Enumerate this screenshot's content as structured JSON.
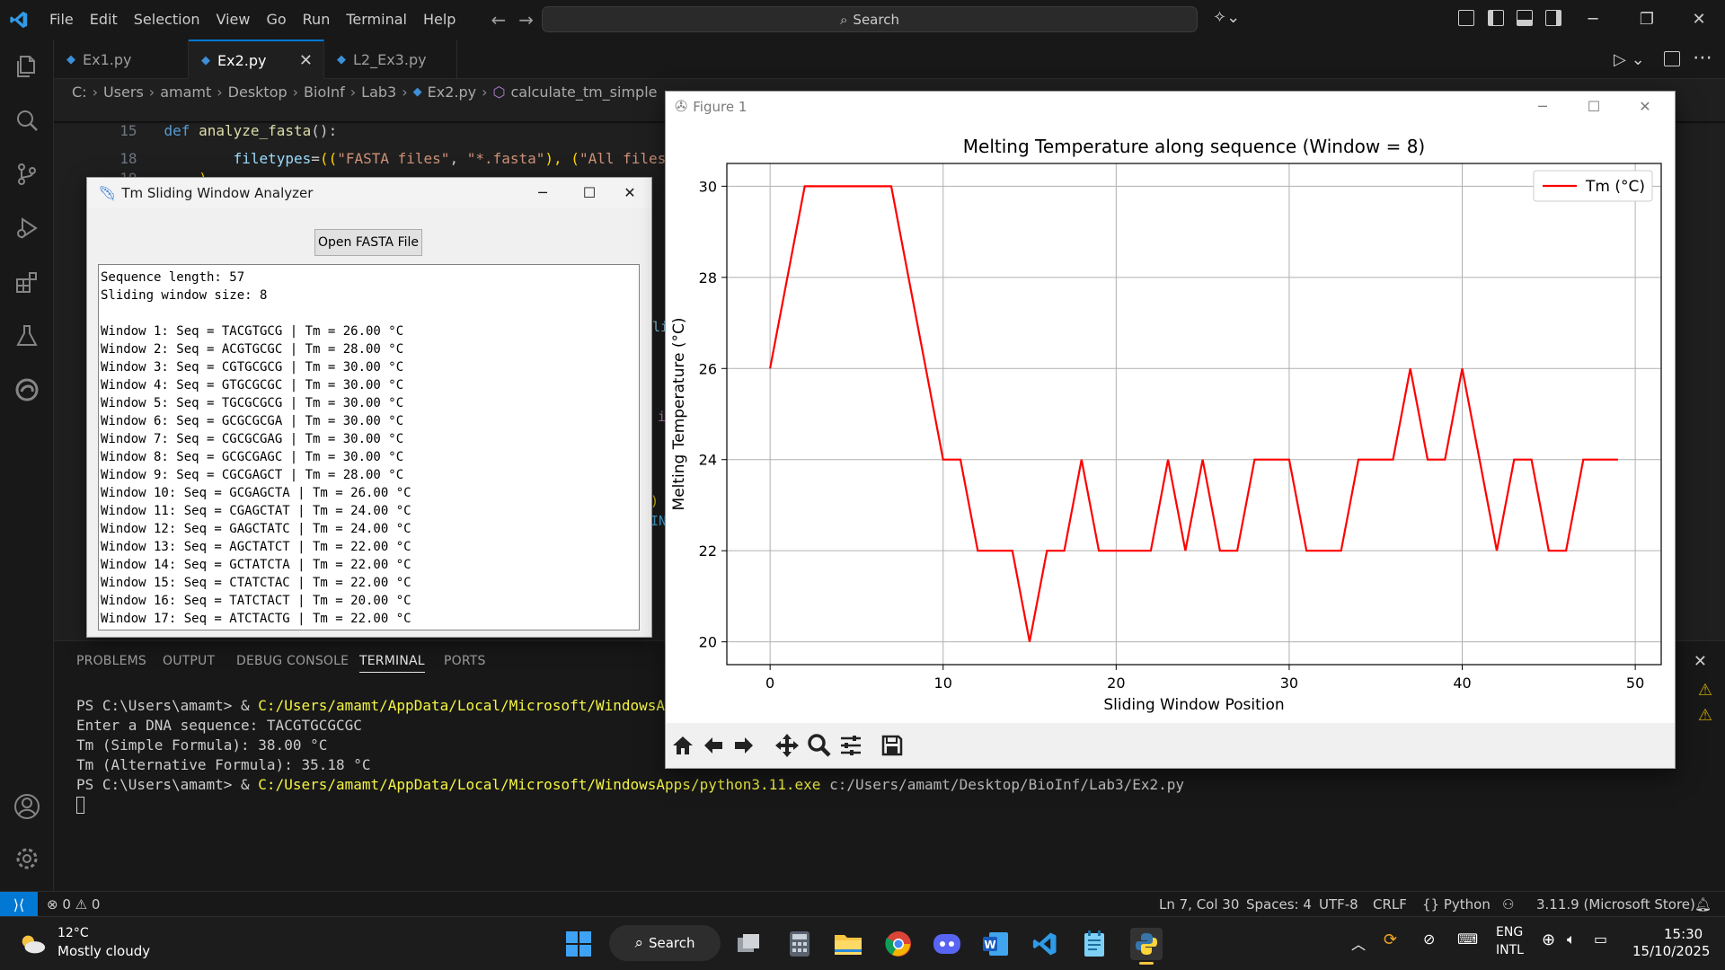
{
  "menu": [
    "File",
    "Edit",
    "Selection",
    "View",
    "Go",
    "Run",
    "Terminal",
    "Help"
  ],
  "command_search": "Search",
  "tabs": [
    {
      "label": "Ex1.py"
    },
    {
      "label": "Ex2.py"
    },
    {
      "label": "L2_Ex3.py"
    }
  ],
  "breadcrumb": [
    "C:",
    "Users",
    "amamt",
    "Desktop",
    "BioInf",
    "Lab3",
    "Ex2.py",
    "calculate_tm_simple"
  ],
  "editor": {
    "line15": {
      "num": "15",
      "kw": "def ",
      "fn": "analyze_fasta",
      "rest": "():"
    },
    "line18": {
      "num": "18",
      "indent": "        ",
      "name": "filetypes",
      "eq": "=",
      "p1": "((",
      "s1": "\"FASTA files\"",
      "c1": ", ",
      "s2": "\"*.fasta\"",
      "c2": "), (",
      "s3": "\"All files\"",
      "c3": ", \""
    },
    "line19": {
      "num": "19",
      "text": "    )"
    },
    "frag_li": "li",
    "frag_i": "i",
    "frag_paren": ")",
    "frag_in": "IN"
  },
  "panel": {
    "tabs": [
      "PROBLEMS",
      "OUTPUT",
      "DEBUG CONSOLE",
      "TERMINAL",
      "PORTS"
    ],
    "terminal": [
      {
        "prefix": "PS C:\\Users\\amamt> & ",
        "yellow": "C:/Users/amamt/AppData/Local/Microsoft/WindowsApps/p",
        "rest": ""
      },
      {
        "prefix": "Enter a DNA sequence: TACGTGCGCGC",
        "yellow": "",
        "rest": ""
      },
      {
        "prefix": "Tm (Simple Formula): 38.00 °C",
        "yellow": "",
        "rest": ""
      },
      {
        "prefix": "Tm (Alternative Formula): 35.18 °C",
        "yellow": "",
        "rest": ""
      },
      {
        "prefix": "PS C:\\Users\\amamt> & ",
        "yellow": "C:/Users/amamt/AppData/Local/Microsoft/WindowsApps/python3.11.exe",
        "rest": " c:/Users/amamt/Desktop/BioInf/Lab3/Ex2.py"
      }
    ]
  },
  "statusbar": {
    "errors": "0",
    "warnings": "0",
    "position": "Ln 7, Col 30",
    "spaces": "Spaces: 4",
    "encoding": "UTF-8",
    "eol": "CRLF",
    "language": "Python",
    "interpreter": "3.11.9 (Microsoft Store)"
  },
  "tk": {
    "title": "Tm Sliding Window Analyzer",
    "button": "Open FASTA File",
    "lines": [
      "Sequence length: 57",
      "Sliding window size: 8",
      "",
      "Window 1: Seq = TACGTGCG | Tm = 26.00 °C",
      "Window 2: Seq = ACGTGCGC | Tm = 28.00 °C",
      "Window 3: Seq = CGTGCGCG | Tm = 30.00 °C",
      "Window 4: Seq = GTGCGCGC | Tm = 30.00 °C",
      "Window 5: Seq = TGCGCGCG | Tm = 30.00 °C",
      "Window 6: Seq = GCGCGCGA | Tm = 30.00 °C",
      "Window 7: Seq = CGCGCGAG | Tm = 30.00 °C",
      "Window 8: Seq = GCGCGAGC | Tm = 30.00 °C",
      "Window 9: Seq = CGCGAGCT | Tm = 28.00 °C",
      "Window 10: Seq = GCGAGCTA | Tm = 26.00 °C",
      "Window 11: Seq = CGAGCTAT | Tm = 24.00 °C",
      "Window 12: Seq = GAGCTATC | Tm = 24.00 °C",
      "Window 13: Seq = AGCTATCT | Tm = 22.00 °C",
      "Window 14: Seq = GCTATCTA | Tm = 22.00 °C",
      "Window 15: Seq = CTATCTAC | Tm = 22.00 °C",
      "Window 16: Seq = TATCTACT | Tm = 20.00 °C",
      "Window 17: Seq = ATCTACTG | Tm = 22.00 °C"
    ]
  },
  "figure": {
    "title": "Figure 1"
  },
  "chart_data": {
    "type": "line",
    "title": "Melting Temperature along sequence (Window = 8)",
    "xlabel": "Sliding Window Position",
    "ylabel": "Melting Temperature (°C)",
    "xlim": [
      -2.5,
      51.5
    ],
    "ylim": [
      19.5,
      30.5
    ],
    "xticks": [
      0,
      10,
      20,
      30,
      40,
      50
    ],
    "yticks": [
      20,
      22,
      24,
      26,
      28,
      30
    ],
    "grid": true,
    "legend_position": "top-right",
    "series": [
      {
        "name": "Tm (°C)",
        "color": "#ff0000",
        "x": [
          0,
          1,
          2,
          3,
          4,
          5,
          6,
          7,
          8,
          9,
          10,
          11,
          12,
          13,
          14,
          15,
          16,
          17,
          18,
          19,
          20,
          21,
          22,
          23,
          24,
          25,
          26,
          27,
          28,
          29,
          30,
          31,
          32,
          33,
          34,
          35,
          36,
          37,
          38,
          39,
          40,
          41,
          42,
          43,
          44,
          45,
          46,
          47,
          48,
          49
        ],
        "y": [
          26,
          28,
          30,
          30,
          30,
          30,
          30,
          30,
          28,
          26,
          24,
          24,
          22,
          22,
          22,
          20,
          22,
          22,
          24,
          22,
          22,
          22,
          22,
          24,
          22,
          24,
          22,
          22,
          24,
          24,
          24,
          22,
          22,
          22,
          24,
          24,
          24,
          26,
          24,
          24,
          26,
          24,
          22,
          24,
          24,
          22,
          22,
          24,
          24,
          24
        ]
      }
    ]
  },
  "taskbar": {
    "temperature": "12°C",
    "weather": "Mostly cloudy",
    "search": "Search",
    "lang1": "ENG",
    "lang2": "INTL",
    "time": "15:30",
    "date": "15/10/2025"
  }
}
